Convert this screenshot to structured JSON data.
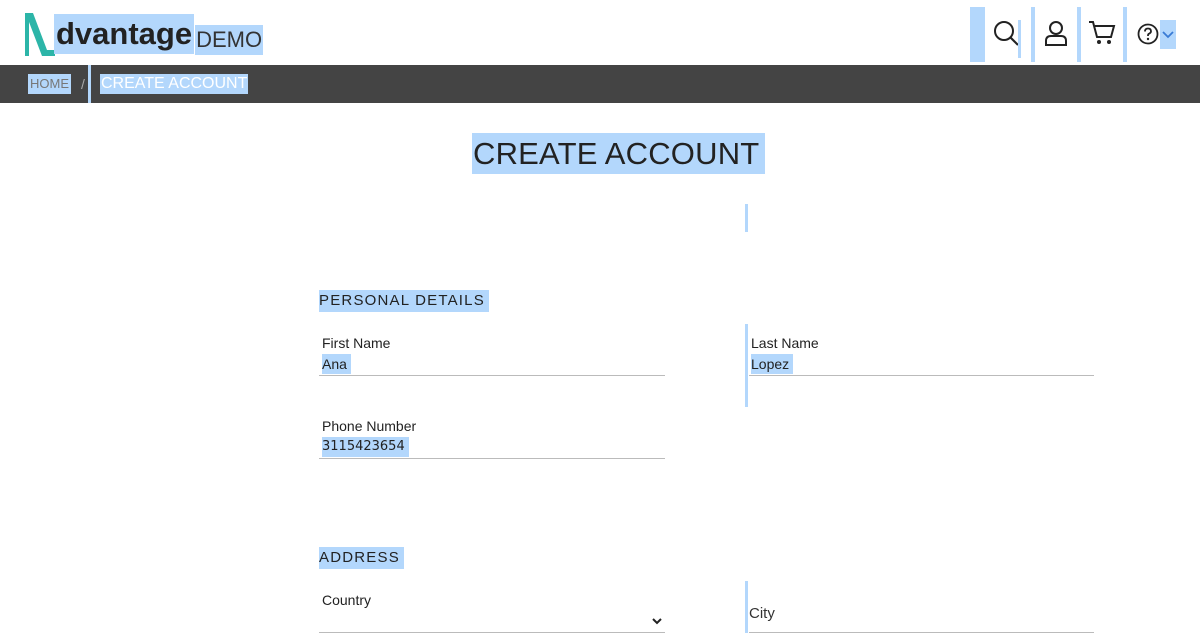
{
  "header": {
    "logo_text": "dvantage",
    "logo_demo": "DEMO",
    "icons": [
      "search-icon",
      "user-icon",
      "cart-icon",
      "help-icon",
      "chevron-down-icon"
    ],
    "brand_color": "#2cb5a8"
  },
  "breadcrumb": {
    "home": "HOME",
    "separator": "/",
    "current": "CREATE ACCOUNT"
  },
  "page": {
    "title": "CREATE ACCOUNT"
  },
  "personal": {
    "section_title": "PERSONAL DETAILS",
    "first_name": {
      "label": "First Name",
      "value": "Ana"
    },
    "last_name": {
      "label": "Last Name",
      "value": "Lopez"
    },
    "phone": {
      "label": "Phone Number",
      "value": "3115423654"
    }
  },
  "address": {
    "section_title": "ADDRESS",
    "country": {
      "label": "Country",
      "value": ""
    },
    "city": {
      "label": "City",
      "value": ""
    }
  },
  "colors": {
    "selection": "#b3d7fc",
    "breadcrumb_bg": "#444444"
  }
}
